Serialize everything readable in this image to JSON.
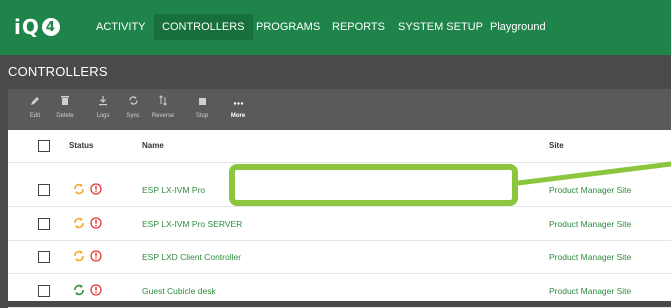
{
  "app": {
    "logo_text": "iQ",
    "logo_badge": "4"
  },
  "nav": {
    "items": [
      {
        "label": "ACTIVITY"
      },
      {
        "label": "CONTROLLERS"
      },
      {
        "label": "PROGRAMS"
      },
      {
        "label": "REPORTS"
      },
      {
        "label": "SYSTEM SETUP"
      },
      {
        "label": "Playground"
      }
    ],
    "active": "CONTROLLERS"
  },
  "page": {
    "title": "CONTROLLERS"
  },
  "toolbar": {
    "items": [
      {
        "label": "Edit",
        "icon": "pencil-icon"
      },
      {
        "label": "Delete",
        "icon": "trash-icon"
      },
      {
        "label": "Logs",
        "icon": "download-icon"
      },
      {
        "label": "Sync",
        "icon": "sync-icon"
      },
      {
        "label": "Reverse",
        "icon": "reverse-icon"
      },
      {
        "label": "Stop",
        "icon": "stop-icon"
      },
      {
        "label": "More",
        "icon": "more-icon"
      }
    ]
  },
  "table": {
    "columns": {
      "status": "Status",
      "name": "Name",
      "site": "Site"
    },
    "rows": [
      {
        "name": "ESP LX-IVM Pro",
        "site": "Product Manager Site"
      },
      {
        "name": "ESP LX-IVM Pro SERVER",
        "site": "Product Manager Site"
      },
      {
        "name": "ESP LXD Client Controller",
        "site": "Product Manager Site"
      },
      {
        "name": "Guest Cubicle desk",
        "site": "Product Manager Site"
      }
    ]
  },
  "colors": {
    "nav_bg": "#1e8449",
    "link": "#2e8b3e",
    "sync_orange": "#f5a623",
    "alert_red": "#e53935",
    "highlight": "#8cc63f"
  }
}
